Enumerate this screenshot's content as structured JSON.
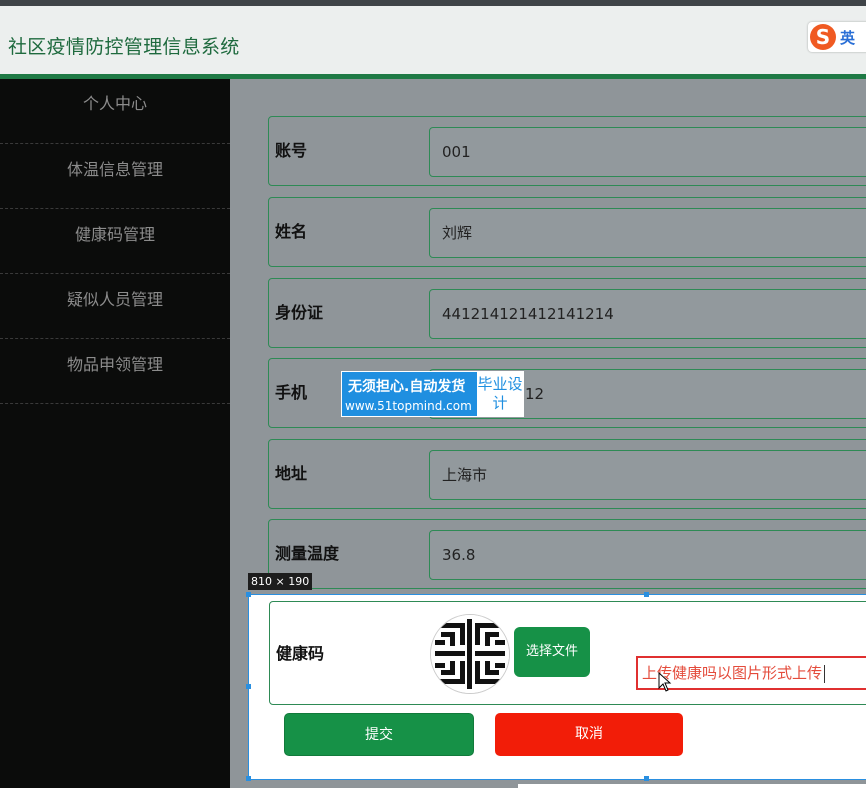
{
  "header": {
    "app_title": "社区疫情防控管理信息系统"
  },
  "ime": {
    "logo_letter": "S",
    "lang": "英"
  },
  "sidebar": {
    "items": [
      {
        "label": "个人中心"
      },
      {
        "label": "体温信息管理"
      },
      {
        "label": "健康码管理"
      },
      {
        "label": "疑似人员管理"
      },
      {
        "label": "物品申领管理"
      }
    ]
  },
  "form": {
    "fields": [
      {
        "label": "账号",
        "value": "001"
      },
      {
        "label": "姓名",
        "value": "刘辉"
      },
      {
        "label": "身份证",
        "value": "441214121412141214"
      },
      {
        "label": "手机",
        "value": "12"
      },
      {
        "label": "地址",
        "value": "上海市"
      },
      {
        "label": "测量温度",
        "value": "36.8"
      }
    ],
    "health_code": {
      "label": "健康码",
      "choose_file": "选择文件",
      "hint": "上传健康吗以图片形式上传"
    },
    "submit": "提交",
    "cancel": "取消"
  },
  "watermark": {
    "line1": "无须担心.自动发货",
    "url": "www.51topmind.com",
    "box": "毕业设计"
  },
  "selection_size": "810 × 190",
  "colors": {
    "brand_green": "#169147",
    "cancel_red": "#f21d08",
    "sidebar_bg": "#0b0c0b"
  }
}
